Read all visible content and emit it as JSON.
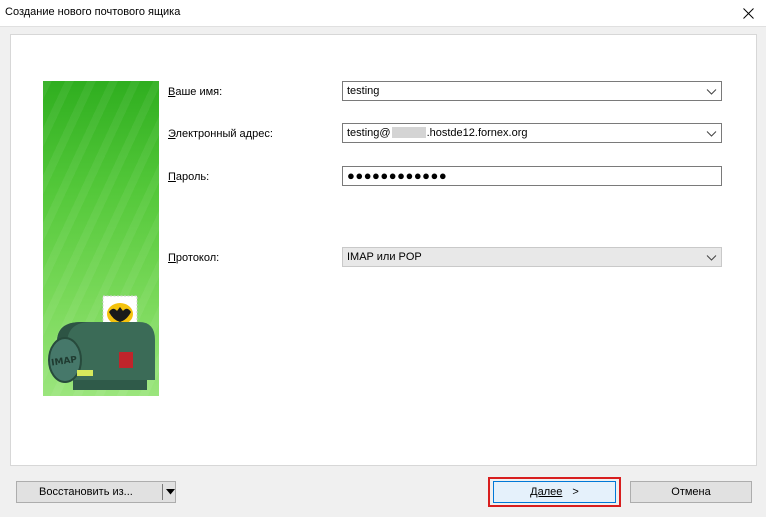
{
  "window": {
    "title": "Создание нового почтового ящика",
    "close_icon": "close-icon"
  },
  "form": {
    "name_label_first": "В",
    "name_label_rest": "аше имя:",
    "name_value": "testing",
    "email_label_first": "Э",
    "email_label_rest": "лектронный адрес:",
    "email_value_prefix": "testing@",
    "email_value_suffix": ".hostde12.fornex.org",
    "password_label_first": "П",
    "password_label_rest": "ароль:",
    "password_value": "●●●●●●●●●●●●",
    "protocol_label_first": "П",
    "protocol_label_rest": "ротокол:",
    "protocol_value": "IMAP или POP"
  },
  "banner": {
    "mailbox_text": "IMAP"
  },
  "buttons": {
    "restore_label": "Восстановить из...",
    "next_label": "Далее",
    "next_arrow": ">",
    "cancel_label": "Отмена"
  },
  "colors": {
    "highlight": "#d81e1e",
    "banner_green": "#54c83a",
    "focus_blue": "#0078d7"
  }
}
